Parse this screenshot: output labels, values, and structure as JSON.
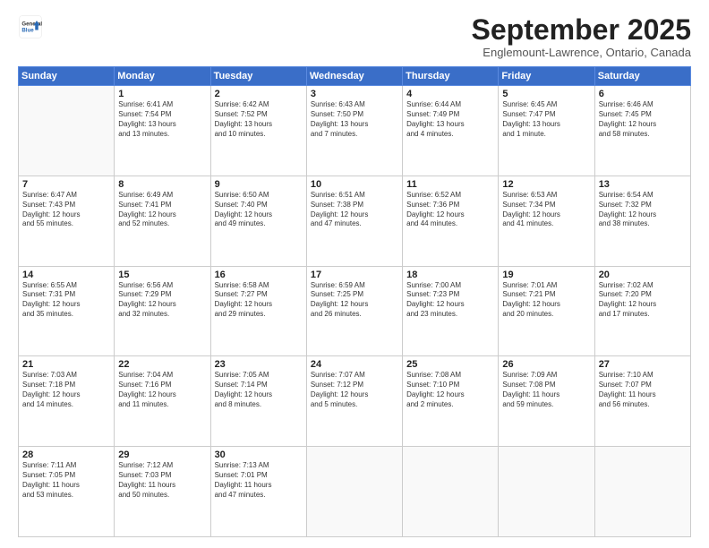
{
  "logo": {
    "general": "General",
    "blue": "Blue"
  },
  "title": "September 2025",
  "subtitle": "Englemount-Lawrence, Ontario, Canada",
  "days": [
    "Sunday",
    "Monday",
    "Tuesday",
    "Wednesday",
    "Thursday",
    "Friday",
    "Saturday"
  ],
  "weeks": [
    [
      {
        "day": "",
        "content": ""
      },
      {
        "day": "1",
        "content": "Sunrise: 6:41 AM\nSunset: 7:54 PM\nDaylight: 13 hours\nand 13 minutes."
      },
      {
        "day": "2",
        "content": "Sunrise: 6:42 AM\nSunset: 7:52 PM\nDaylight: 13 hours\nand 10 minutes."
      },
      {
        "day": "3",
        "content": "Sunrise: 6:43 AM\nSunset: 7:50 PM\nDaylight: 13 hours\nand 7 minutes."
      },
      {
        "day": "4",
        "content": "Sunrise: 6:44 AM\nSunset: 7:49 PM\nDaylight: 13 hours\nand 4 minutes."
      },
      {
        "day": "5",
        "content": "Sunrise: 6:45 AM\nSunset: 7:47 PM\nDaylight: 13 hours\nand 1 minute."
      },
      {
        "day": "6",
        "content": "Sunrise: 6:46 AM\nSunset: 7:45 PM\nDaylight: 12 hours\nand 58 minutes."
      }
    ],
    [
      {
        "day": "7",
        "content": "Sunrise: 6:47 AM\nSunset: 7:43 PM\nDaylight: 12 hours\nand 55 minutes."
      },
      {
        "day": "8",
        "content": "Sunrise: 6:49 AM\nSunset: 7:41 PM\nDaylight: 12 hours\nand 52 minutes."
      },
      {
        "day": "9",
        "content": "Sunrise: 6:50 AM\nSunset: 7:40 PM\nDaylight: 12 hours\nand 49 minutes."
      },
      {
        "day": "10",
        "content": "Sunrise: 6:51 AM\nSunset: 7:38 PM\nDaylight: 12 hours\nand 47 minutes."
      },
      {
        "day": "11",
        "content": "Sunrise: 6:52 AM\nSunset: 7:36 PM\nDaylight: 12 hours\nand 44 minutes."
      },
      {
        "day": "12",
        "content": "Sunrise: 6:53 AM\nSunset: 7:34 PM\nDaylight: 12 hours\nand 41 minutes."
      },
      {
        "day": "13",
        "content": "Sunrise: 6:54 AM\nSunset: 7:32 PM\nDaylight: 12 hours\nand 38 minutes."
      }
    ],
    [
      {
        "day": "14",
        "content": "Sunrise: 6:55 AM\nSunset: 7:31 PM\nDaylight: 12 hours\nand 35 minutes."
      },
      {
        "day": "15",
        "content": "Sunrise: 6:56 AM\nSunset: 7:29 PM\nDaylight: 12 hours\nand 32 minutes."
      },
      {
        "day": "16",
        "content": "Sunrise: 6:58 AM\nSunset: 7:27 PM\nDaylight: 12 hours\nand 29 minutes."
      },
      {
        "day": "17",
        "content": "Sunrise: 6:59 AM\nSunset: 7:25 PM\nDaylight: 12 hours\nand 26 minutes."
      },
      {
        "day": "18",
        "content": "Sunrise: 7:00 AM\nSunset: 7:23 PM\nDaylight: 12 hours\nand 23 minutes."
      },
      {
        "day": "19",
        "content": "Sunrise: 7:01 AM\nSunset: 7:21 PM\nDaylight: 12 hours\nand 20 minutes."
      },
      {
        "day": "20",
        "content": "Sunrise: 7:02 AM\nSunset: 7:20 PM\nDaylight: 12 hours\nand 17 minutes."
      }
    ],
    [
      {
        "day": "21",
        "content": "Sunrise: 7:03 AM\nSunset: 7:18 PM\nDaylight: 12 hours\nand 14 minutes."
      },
      {
        "day": "22",
        "content": "Sunrise: 7:04 AM\nSunset: 7:16 PM\nDaylight: 12 hours\nand 11 minutes."
      },
      {
        "day": "23",
        "content": "Sunrise: 7:05 AM\nSunset: 7:14 PM\nDaylight: 12 hours\nand 8 minutes."
      },
      {
        "day": "24",
        "content": "Sunrise: 7:07 AM\nSunset: 7:12 PM\nDaylight: 12 hours\nand 5 minutes."
      },
      {
        "day": "25",
        "content": "Sunrise: 7:08 AM\nSunset: 7:10 PM\nDaylight: 12 hours\nand 2 minutes."
      },
      {
        "day": "26",
        "content": "Sunrise: 7:09 AM\nSunset: 7:08 PM\nDaylight: 11 hours\nand 59 minutes."
      },
      {
        "day": "27",
        "content": "Sunrise: 7:10 AM\nSunset: 7:07 PM\nDaylight: 11 hours\nand 56 minutes."
      }
    ],
    [
      {
        "day": "28",
        "content": "Sunrise: 7:11 AM\nSunset: 7:05 PM\nDaylight: 11 hours\nand 53 minutes."
      },
      {
        "day": "29",
        "content": "Sunrise: 7:12 AM\nSunset: 7:03 PM\nDaylight: 11 hours\nand 50 minutes."
      },
      {
        "day": "30",
        "content": "Sunrise: 7:13 AM\nSunset: 7:01 PM\nDaylight: 11 hours\nand 47 minutes."
      },
      {
        "day": "",
        "content": ""
      },
      {
        "day": "",
        "content": ""
      },
      {
        "day": "",
        "content": ""
      },
      {
        "day": "",
        "content": ""
      }
    ]
  ]
}
